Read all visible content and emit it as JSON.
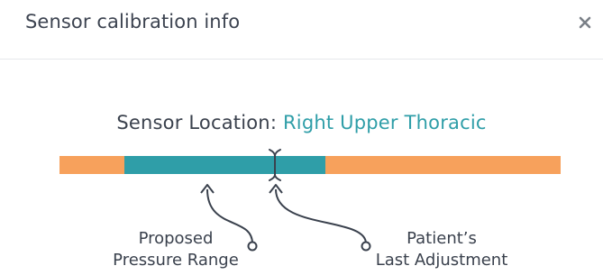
{
  "modal": {
    "title": "Sensor calibration info",
    "close_icon": "close-icon"
  },
  "sensor": {
    "location_label": "Sensor Location:",
    "location_value": "Right Upper Thoracic"
  },
  "range_bar": {
    "proposed_range_start_fraction": 0.13,
    "proposed_range_end_fraction": 0.53,
    "patient_last_adjustment_fraction": 0.43,
    "colors": {
      "outer": "#f7a15c",
      "proposed": "#2f9ea8",
      "marker": "#3a414d"
    }
  },
  "callouts": {
    "proposed_line1": "Proposed",
    "proposed_line2": "Pressure Range",
    "patient_line1": "Patient’s",
    "patient_line2": "Last Adjustment"
  }
}
